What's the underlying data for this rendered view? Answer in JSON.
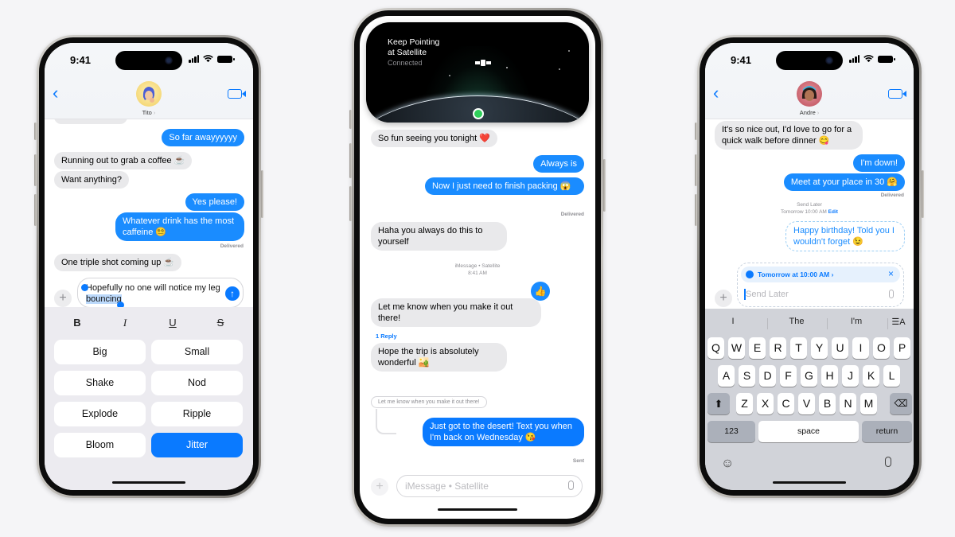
{
  "phones": {
    "left": {
      "status": {
        "time": "9:41"
      },
      "header": {
        "contact_name": "Tito",
        "back_icon": "chevron-left-icon",
        "video_icon": "video-camera-icon"
      },
      "messages": [
        {
          "direction": "incoming",
          "text": "…",
          "partial": true
        },
        {
          "direction": "outgoing",
          "text": "So far awayyyyyy"
        },
        {
          "direction": "incoming",
          "text": "Running out to grab a coffee ☕"
        },
        {
          "direction": "incoming",
          "text": "Want anything?"
        },
        {
          "direction": "outgoing",
          "text": "Yes please!"
        },
        {
          "direction": "outgoing",
          "text": "Whatever drink has the most caffeine 😵‍💫"
        },
        {
          "direction": "incoming",
          "text": "One triple shot coming up ☕"
        }
      ],
      "delivered_label": "Delivered",
      "compose": {
        "text_before": "Hopefully no one will notice my leg",
        "text_selected": "bouncing",
        "send_icon": "arrow-up-icon",
        "plus_icon": "plus-icon"
      },
      "formatting": {
        "styles": [
          {
            "label": "B",
            "name": "bold"
          },
          {
            "label": "I",
            "name": "italic"
          },
          {
            "label": "U",
            "name": "underline"
          },
          {
            "label": "S",
            "name": "strikethrough"
          }
        ],
        "effects": [
          {
            "label": "Big",
            "selected": false
          },
          {
            "label": "Small",
            "selected": false
          },
          {
            "label": "Shake",
            "selected": false
          },
          {
            "label": "Nod",
            "selected": false
          },
          {
            "label": "Explode",
            "selected": false
          },
          {
            "label": "Ripple",
            "selected": false
          },
          {
            "label": "Bloom",
            "selected": false
          },
          {
            "label": "Jitter",
            "selected": true
          }
        ]
      }
    },
    "middle": {
      "live_activity": {
        "title_line1": "Keep Pointing",
        "title_line2": "at Satellite",
        "status": "Connected",
        "satellite_icon": "satellite-icon",
        "location_icon": "location-dot-icon"
      },
      "messages": [
        {
          "direction": "incoming",
          "text": "So fun seeing you tonight ❤️"
        },
        {
          "direction": "outgoing",
          "text": "Always is"
        },
        {
          "direction": "outgoing",
          "text": "Now I just need to finish packing 😱"
        },
        {
          "direction": "incoming",
          "text": "Haha you always do this to yourself"
        },
        {
          "direction": "incoming",
          "text": "Let me know when you make it out there!",
          "reaction": "👍"
        },
        {
          "direction": "incoming",
          "text": "Hope the trip is absolutely wonderful 🏜️"
        },
        {
          "direction": "outgoing",
          "text": "Just got to the desert! Text you when I'm back on Wednesday 😘"
        }
      ],
      "delivered_label": "Delivered",
      "service_label": "iMessage • Satellite",
      "service_time": "8:41 AM",
      "reply_count": "1 Reply",
      "reply_quote": "Let me know when you make it out there!",
      "sent_label": "Sent",
      "compose": {
        "placeholder": "iMessage • Satellite",
        "mic_icon": "microphone-icon",
        "plus_icon": "plus-icon"
      }
    },
    "right": {
      "status": {
        "time": "9:41"
      },
      "header": {
        "contact_name": "Andre",
        "back_icon": "chevron-left-icon",
        "video_icon": "video-camera-icon"
      },
      "messages": [
        {
          "direction": "incoming",
          "text": "It's so nice out, I'd love to go for a quick walk before dinner 😋"
        },
        {
          "direction": "outgoing",
          "text": "I'm down!"
        },
        {
          "direction": "outgoing",
          "text": "Meet at your place in 30 🤗"
        },
        {
          "direction": "scheduled",
          "text": "Happy birthday! Told you I wouldn't forget 😉"
        }
      ],
      "delivered_label": "Delivered",
      "send_later": {
        "label": "Send Later",
        "time": "Tomorrow 10:00 AM",
        "edit": "Edit"
      },
      "compose": {
        "schedule_chip": "Tomorrow at 10:00 AM ›",
        "placeholder": "Send Later",
        "clock_icon": "clock-icon",
        "close_icon": "close-icon",
        "mic_icon": "microphone-icon",
        "plus_icon": "plus-icon"
      },
      "keyboard": {
        "suggestions": [
          "I",
          "The",
          "I'm"
        ],
        "format_icon": "text-format-icon",
        "row1": [
          "Q",
          "W",
          "E",
          "R",
          "T",
          "Y",
          "U",
          "I",
          "O",
          "P"
        ],
        "row2": [
          "A",
          "S",
          "D",
          "F",
          "G",
          "H",
          "J",
          "K",
          "L"
        ],
        "row3": [
          "Z",
          "X",
          "C",
          "V",
          "B",
          "N",
          "M"
        ],
        "shift_icon": "shift-icon",
        "delete_icon": "delete-backspace-icon",
        "numbers_label": "123",
        "space_label": "space",
        "return_label": "return",
        "emoji_icon": "emoji-icon",
        "dictation_icon": "microphone-icon"
      }
    }
  }
}
